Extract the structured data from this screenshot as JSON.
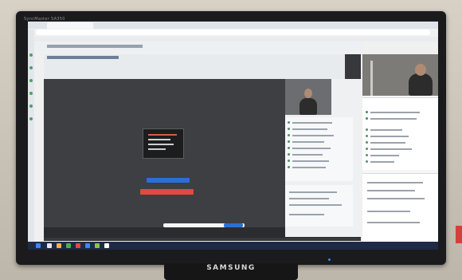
{
  "monitor": {
    "brand": "SAMSUNG",
    "model_label": "SyncMaster SA350"
  },
  "colors": {
    "bezel": "#1b1b1d",
    "wall": "#c9c2b6",
    "presenter_bg": "#36383b",
    "accent_blue": "#2b6fd6",
    "accent_red": "#e24a3b",
    "taskbar": "#1f2a44"
  },
  "screen_content": {
    "description_icons": [
      "browser-icon",
      "camera-icon",
      "chat-icon",
      "participants-icon"
    ]
  }
}
